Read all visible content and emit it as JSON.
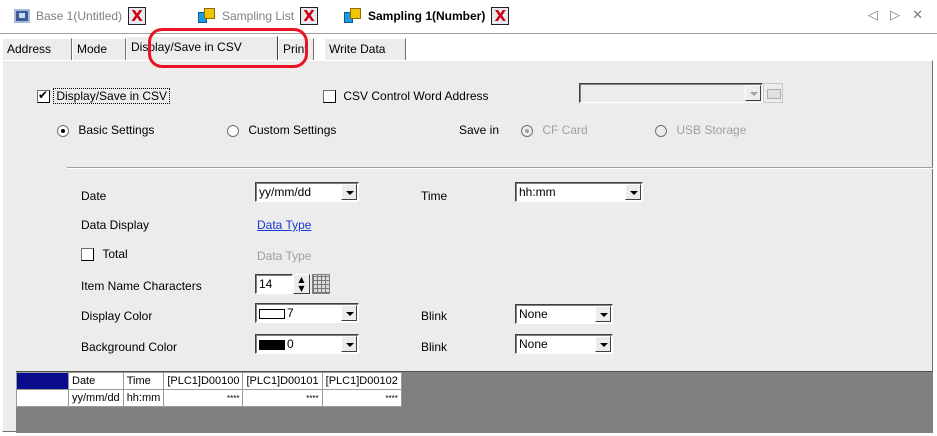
{
  "doc_tabs": [
    {
      "label": "Base 1(Untitled)",
      "active": false
    },
    {
      "label": "Sampling List",
      "active": false
    },
    {
      "label": "Sampling 1(Number)",
      "active": true
    }
  ],
  "doc_tabs_nav": "◁ ▷ ✕",
  "close_glyph": "X",
  "sub_tabs": [
    {
      "label": "Address"
    },
    {
      "label": "Mode"
    },
    {
      "label": "Display/Save in CSV"
    },
    {
      "label": "Print"
    },
    {
      "label": "Write Data"
    }
  ],
  "panel": {
    "display_save_csv": {
      "label": "Display/Save in CSV",
      "checked": true
    },
    "csv_control": {
      "label": "CSV Control Word Address",
      "checked": false,
      "value": ""
    },
    "basic_settings": {
      "label": "Basic Settings",
      "selected": true
    },
    "custom_settings": {
      "label": "Custom Settings",
      "selected": false
    },
    "save_in": {
      "label": "Save in",
      "cf_card": "CF Card",
      "usb_storage": "USB Storage"
    },
    "date": {
      "label": "Date",
      "value": "yy/mm/dd"
    },
    "time": {
      "label": "Time",
      "value": "hh:mm"
    },
    "data_display": {
      "label": "Data Display",
      "link": "Data Type"
    },
    "total": {
      "label": "Total",
      "checked": false,
      "value": "Data Type"
    },
    "item_name_chars": {
      "label": "Item Name Characters",
      "value": "14"
    },
    "display_color": {
      "label": "Display Color",
      "value": "7",
      "swatch": "#ffffff"
    },
    "blink1": {
      "label": "Blink",
      "value": "None"
    },
    "background_color": {
      "label": "Background Color",
      "value": "0",
      "swatch": "#000000"
    },
    "blink2": {
      "label": "Blink",
      "value": "None"
    }
  },
  "preview": {
    "headers": [
      "Date",
      "Time",
      "[PLC1]D00100",
      "[PLC1]D00101",
      "[PLC1]D00102"
    ],
    "row": [
      "yy/mm/dd",
      "hh:mm",
      "****",
      "****",
      "****"
    ]
  },
  "colors": {
    "highlight": "#e81424",
    "link": "#1a38d6",
    "close": "#d00010"
  }
}
